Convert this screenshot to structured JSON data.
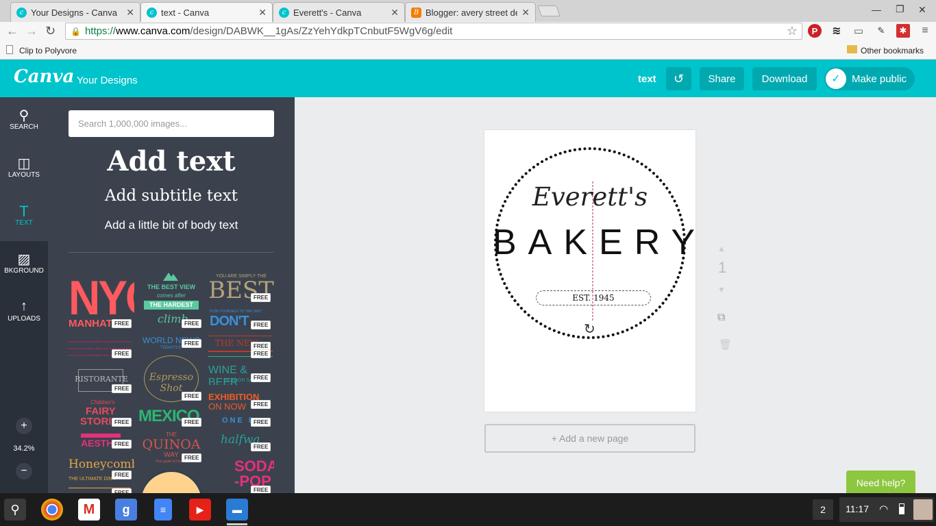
{
  "browser": {
    "tabs": [
      {
        "title": "Your Designs - Canva",
        "icon": "canva-icon"
      },
      {
        "title": "text - Canva",
        "icon": "canva-icon"
      },
      {
        "title": "Everett's - Canva",
        "icon": "canva-icon"
      },
      {
        "title": "Blogger: avery street des",
        "icon": "blogger-icon"
      }
    ],
    "url_scheme": "https://",
    "url_host": "www.canva.com",
    "url_path": "/design/DABWK__1gAs/ZzYehYdkpTCnbutF5WgV6g/edit",
    "bookmark_left": "Clip to Polyvore",
    "bookmark_right": "Other bookmarks"
  },
  "canva": {
    "logo": "Canva",
    "your_designs": "Your Designs",
    "doc_name": "text",
    "share_label": "Share",
    "download_label": "Download",
    "make_public_label": "Make public"
  },
  "rail": {
    "items": [
      {
        "label": "SEARCH",
        "icon": "search-icon"
      },
      {
        "label": "LAYOUTS",
        "icon": "layouts-icon"
      },
      {
        "label": "TEXT",
        "icon": "text-icon"
      },
      {
        "label": "BKGROUND",
        "icon": "background-icon"
      },
      {
        "label": "UPLOADS",
        "icon": "upload-icon"
      }
    ],
    "zoom": "34.2%",
    "zoom_in": "+",
    "zoom_out": "−"
  },
  "panel": {
    "search_placeholder": "Search 1,000,000 images...",
    "add_text": "Add text",
    "add_subtitle": "Add subtitle text",
    "add_body": "Add a little bit of body text",
    "free_badge": "FREE",
    "templates": {
      "nyc": "NYC",
      "manhattan": "MANHAT",
      "best_view": "THE BEST VIEW",
      "comes_after": "comes after",
      "the_hardest": "THE HARDEST",
      "climb": "climb",
      "you_are": "YOU ARE SIMPLY THE",
      "best": "BEST",
      "push": "PUSH YOURSELF TO THE LIMIT",
      "dont_quit": "DON'T QUIT",
      "world_news": "WORLD NEWS",
      "todays": "TODAY'S E",
      "the_news": "THE NEW",
      "ristorante": "RISTORANTE",
      "espresso": "Espresso Shot",
      "wine": "WINE & BEER",
      "now_on": "NOW ON SA",
      "exhibition": "EXHIBITION",
      "on_now": "ON NOW",
      "childrens": "Children's",
      "fairy": "FAIRY",
      "stories": "STORIE",
      "mexico": "MEXICO",
      "one_day": "ONE D",
      "aesth": "AESTH",
      "the_quinoa_the": "THE",
      "quinoa": "QUINOA",
      "way": "WAY",
      "guide": "Your guide to healthy",
      "halfway": "halfwa",
      "honeycomb": "Honeycomb",
      "ultimate": "THE ULTIMATE DINN",
      "soda": "SODA",
      "pop": "-POP"
    }
  },
  "design": {
    "script_name": "Everett's",
    "title": "BAKERY",
    "established": "EST. 1945"
  },
  "workspace": {
    "page_number": "1",
    "add_page": "+ Add a new page",
    "need_help": "Need help?"
  },
  "taskbar": {
    "notifications": "2",
    "time": "11:17"
  }
}
